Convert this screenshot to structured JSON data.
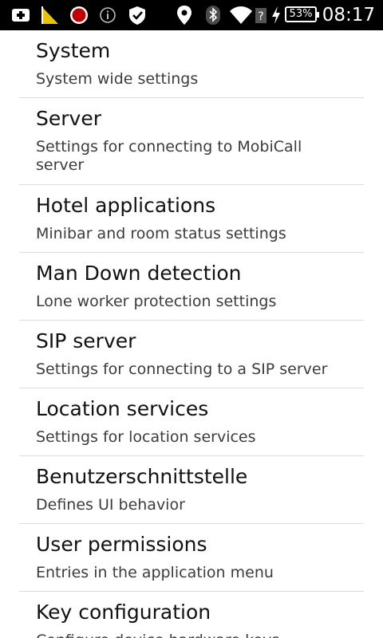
{
  "status_bar": {
    "battery_percent": "53%",
    "time": "08:17",
    "icons": [
      "add-icon",
      "warning-flag-icon",
      "record-icon",
      "info-icon",
      "shield-icon",
      "location-pin-icon",
      "bluetooth-icon",
      "wifi-icon",
      "no-sim-icon",
      "charging-icon",
      "battery-icon"
    ]
  },
  "settings": {
    "items": [
      {
        "title": "System",
        "summary": "System wide settings"
      },
      {
        "title": "Server",
        "summary": "Settings for connecting to MobiCall server"
      },
      {
        "title": "Hotel applications",
        "summary": "Minibar and room status settings"
      },
      {
        "title": "Man Down detection",
        "summary": "Lone worker protection settings"
      },
      {
        "title": "SIP server",
        "summary": "Settings for connecting to a SIP server"
      },
      {
        "title": "Location services",
        "summary": "Settings for location services"
      },
      {
        "title": "Benutzerschnittstelle",
        "summary": "Defines UI behavior"
      },
      {
        "title": "User permissions",
        "summary": "Entries in the application menu"
      },
      {
        "title": "Key configuration",
        "summary": "Configure device hardware keys"
      }
    ]
  }
}
